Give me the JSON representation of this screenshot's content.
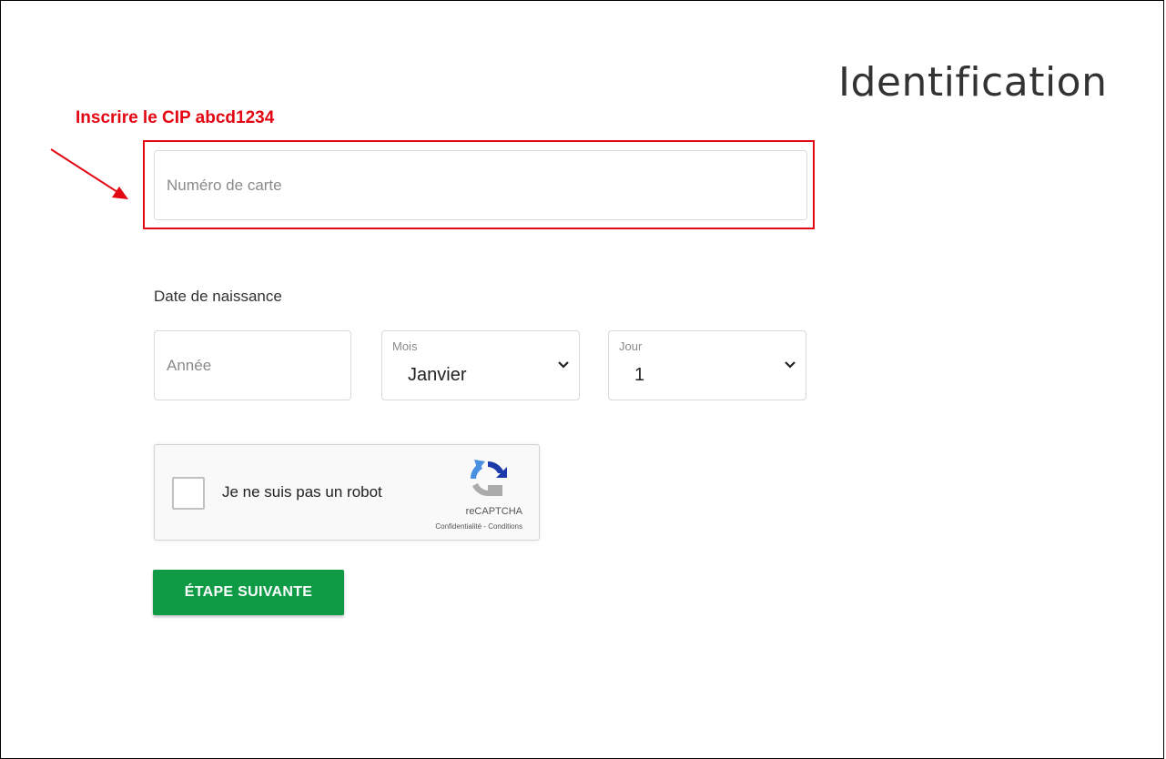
{
  "page": {
    "title": "Identification"
  },
  "annotation": {
    "instruction": "Inscrire le CIP abcd1234",
    "accent_color": "#e30613"
  },
  "form": {
    "card_number": {
      "placeholder": "Numéro de carte",
      "value": ""
    },
    "birth_date": {
      "label": "Date de naissance",
      "year": {
        "placeholder": "Année",
        "value": ""
      },
      "month": {
        "label": "Mois",
        "selected": "Janvier",
        "icon": "chevron-down-icon"
      },
      "day": {
        "label": "Jour",
        "selected": "1",
        "icon": "chevron-down-icon"
      }
    },
    "recaptcha": {
      "checkbox_label": "Je ne suis pas un robot",
      "checked": false,
      "brand": "reCAPTCHA",
      "privacy_link": "Confidentialité",
      "separator": " - ",
      "terms_link": "Conditions",
      "icon": "recaptcha-logo-icon"
    },
    "next_button": {
      "label": "ÉTAPE SUIVANTE",
      "color": "#0f9a45"
    }
  }
}
